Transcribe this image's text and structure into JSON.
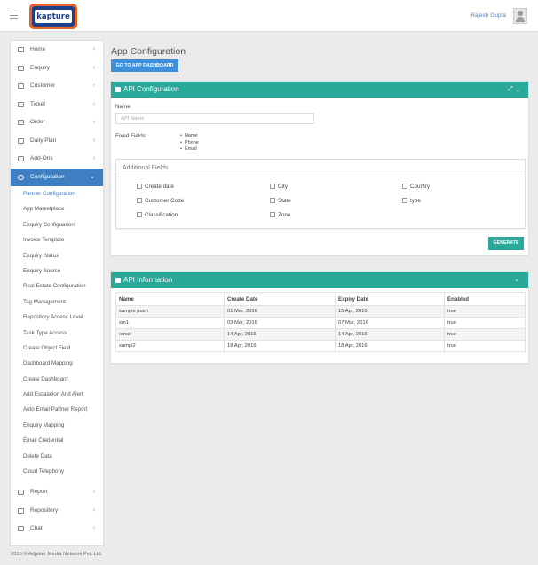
{
  "header": {
    "logo_text": "kapture",
    "user_name": "Rajesh Gupta"
  },
  "sidebar": {
    "top_items": [
      {
        "label": "Home",
        "icon": "home-icon"
      },
      {
        "label": "Enquiry",
        "icon": "enquiry-icon"
      },
      {
        "label": "Customer",
        "icon": "customer-icon"
      },
      {
        "label": "Ticket",
        "icon": "ticket-icon"
      },
      {
        "label": "Order",
        "icon": "order-icon"
      },
      {
        "label": "Daily Plan",
        "icon": "calendar-icon"
      },
      {
        "label": "Add-Ons",
        "icon": "addons-icon"
      },
      {
        "label": "Configuration",
        "icon": "gear-icon"
      }
    ],
    "config_items": [
      "Partner Configuration",
      "App Marketplace",
      "Enquiry Configuarion",
      "Invoice Template",
      "Enquiry Status",
      "Enquiry Source",
      "Real Estate Configuration",
      "Tag Management",
      "Repository Access Level",
      "Task Type Access",
      "Create Object Field",
      "Dashboard Mapping",
      "Create Dashboard",
      "Add Escalation And Alert",
      "Auto Email Partner Report",
      "Enquiry Mapping",
      "Email Credential",
      "Delete Data",
      "Cloud Telephony"
    ],
    "bottom_items": [
      {
        "label": "Report",
        "icon": "report-icon"
      },
      {
        "label": "Repository",
        "icon": "repository-icon"
      },
      {
        "label": "Chat",
        "icon": "chat-icon"
      }
    ]
  },
  "main": {
    "page_title": "App Configuration",
    "dashboard_button": "GO TO APP DASHBOARD",
    "api_config": {
      "title": "API Configuration",
      "name_label": "Name",
      "name_placeholder": "API Name",
      "fixed_label": "Fixed Fields:",
      "fixed_fields": [
        "Name",
        "Phone",
        "Email"
      ],
      "additional_title": "Additional Fields",
      "fields": [
        [
          "Create date",
          "City",
          "Country"
        ],
        [
          "Customer Code",
          "State",
          "type"
        ],
        [
          "Classification",
          "Zone"
        ]
      ],
      "generate_button": "GENERATE"
    },
    "api_info": {
      "title": "API Information",
      "columns": [
        "Name",
        "Create Date",
        "Expiry Date",
        "Enabled"
      ],
      "rows": [
        [
          "sample push",
          "01 Mar, 2016",
          "15 Apr, 2016",
          "true"
        ],
        [
          "sm1",
          "03 Mar, 2016",
          "07 Mar, 2016",
          "true"
        ],
        [
          "email",
          "14 Apr, 2016",
          "14 Apr, 2016",
          "true"
        ],
        [
          "sampl2",
          "18 Apr, 2016",
          "18 Apr, 2016",
          "true"
        ]
      ]
    }
  },
  "footer": "2015 © Adjetter Media Network Pvt. Ltd.",
  "colors": {
    "teal": "#2aa899",
    "blue": "#3d7fc1",
    "button_blue": "#3d8fd9"
  }
}
